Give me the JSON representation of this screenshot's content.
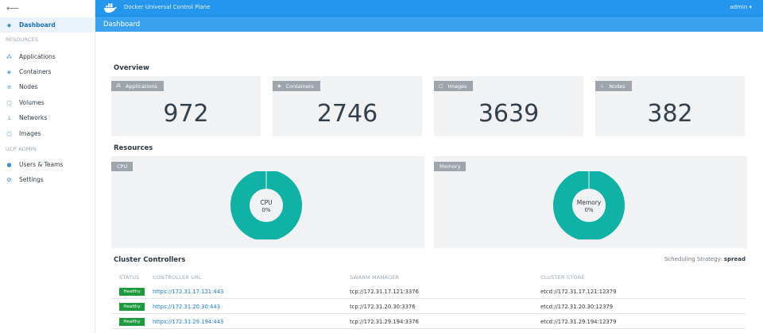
{
  "topbar": {
    "title": "Docker Universal Control Plane",
    "user": "admin ▾"
  },
  "subbar": {
    "title": "Dashboard"
  },
  "sidebar": {
    "back": "⟵",
    "section_resources": "RESOURCES",
    "section_admin": "UCP ADMIN",
    "items": [
      {
        "label": "Dashboard",
        "icon": "dashboard-icon"
      },
      {
        "label": "Applications",
        "icon": "applications-icon"
      },
      {
        "label": "Containers",
        "icon": "containers-icon"
      },
      {
        "label": "Nodes",
        "icon": "nodes-icon"
      },
      {
        "label": "Volumes",
        "icon": "volumes-icon"
      },
      {
        "label": "Networks",
        "icon": "networks-icon"
      },
      {
        "label": "Images",
        "icon": "images-icon"
      },
      {
        "label": "Users & Teams",
        "icon": "users-icon"
      },
      {
        "label": "Settings",
        "icon": "settings-icon"
      }
    ]
  },
  "overview": {
    "heading": "Overview",
    "cards": [
      {
        "label": "Applications",
        "value": "972",
        "icon": "applications-icon"
      },
      {
        "label": "Containers",
        "value": "2746",
        "icon": "containers-icon"
      },
      {
        "label": "Images",
        "value": "3639",
        "icon": "images-icon"
      },
      {
        "label": "Nodes",
        "value": "382",
        "icon": "nodes-icon"
      }
    ]
  },
  "resources": {
    "heading": "Resources",
    "cpu": {
      "tag": "CPU",
      "label": "CPU",
      "value_text": "0%",
      "percent": 0
    },
    "memory": {
      "tag": "Memory",
      "label": "Memory",
      "value_text": "0%",
      "percent": 0
    },
    "colors": {
      "ring": "#0fb2a5",
      "divider": "#e8f6f5"
    }
  },
  "controllers": {
    "heading": "Cluster Controllers",
    "strategy_label": "Scheduling Strategy:",
    "strategy_value": "spread",
    "columns": [
      "STATUS",
      "CONTROLLER URL",
      "SWARM MANAGER",
      "CLUSTER STORE"
    ],
    "rows": [
      {
        "status": "Healthy",
        "url": "https://172.31.17.121:443",
        "swarm": "tcp://172.31.17.121:3376",
        "store": "etcd://172.31.17.121:12379"
      },
      {
        "status": "Healthy",
        "url": "https://172.31.20.30:443",
        "swarm": "tcp://172.31.20.30:3376",
        "store": "etcd://172.31.20.30:12379"
      },
      {
        "status": "Healthy",
        "url": "https://172.31.29.194:443",
        "swarm": "tcp://172.31.29.194:3376",
        "store": "etcd://172.31.29.194:12379"
      }
    ]
  }
}
